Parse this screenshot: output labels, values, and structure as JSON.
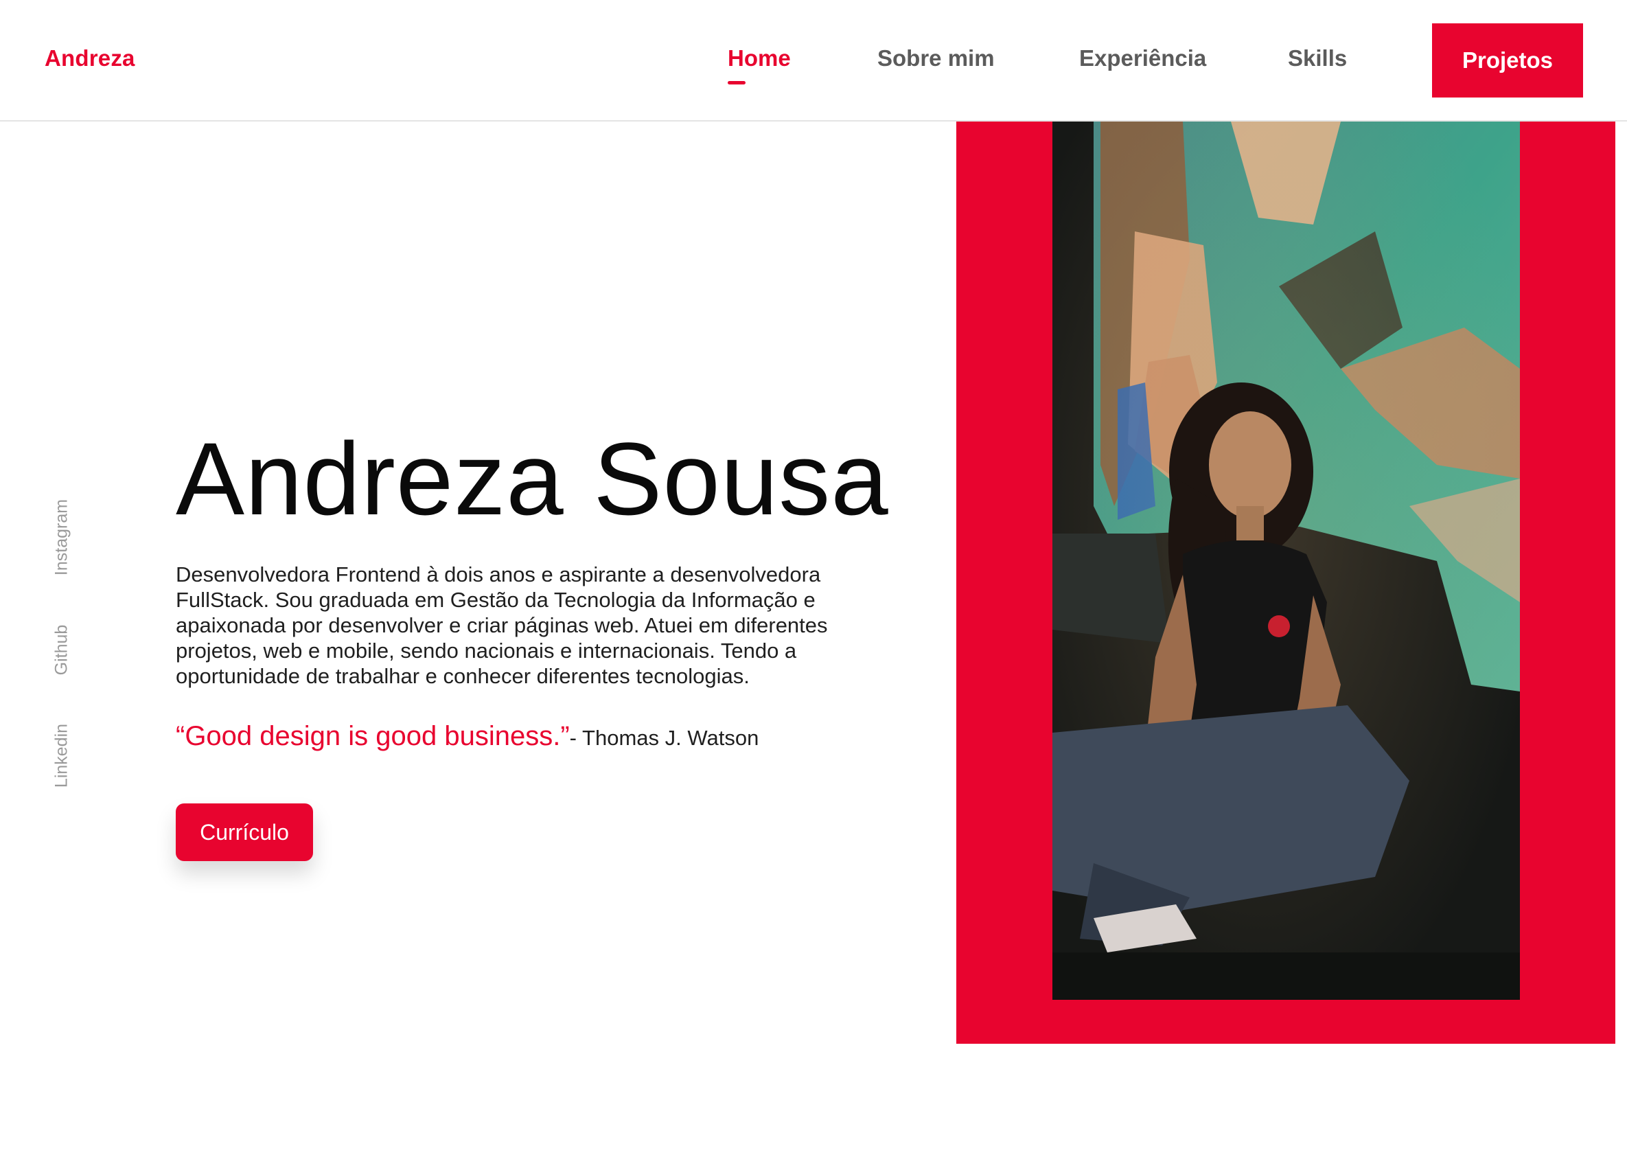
{
  "header": {
    "brand": "Andreza",
    "nav": [
      {
        "label": "Home",
        "active": true
      },
      {
        "label": "Sobre mim",
        "active": false
      },
      {
        "label": "Experiência",
        "active": false
      },
      {
        "label": "Skills",
        "active": false
      }
    ],
    "cta_label": "Projetos"
  },
  "social": {
    "instagram": "Instagram",
    "github": "Github",
    "linkedin": "Linkedin"
  },
  "hero": {
    "name": "Andreza Sousa",
    "description": "Desenvolvedora Frontend à dois anos e aspirante a desenvolvedora FullStack. Sou graduada em Gestão da Tecnologia da Informação e apaixonada por desenvolver e criar páginas web. Atuei em diferentes projetos, web e mobile, sendo nacionais e internacionais. Tendo a oportunidade de trabalhar e conhecer diferentes tecnologias.",
    "quote": "“Good design is good business.”",
    "quote_author": "- Thomas J. Watson",
    "cv_button": "Currículo"
  },
  "colors": {
    "accent": "#e8042f",
    "text": "#0a0a0a",
    "muted": "#9a9a9a",
    "nav_text": "#5b5b5b"
  },
  "icons": {
    "photo": "portrait-photo"
  }
}
